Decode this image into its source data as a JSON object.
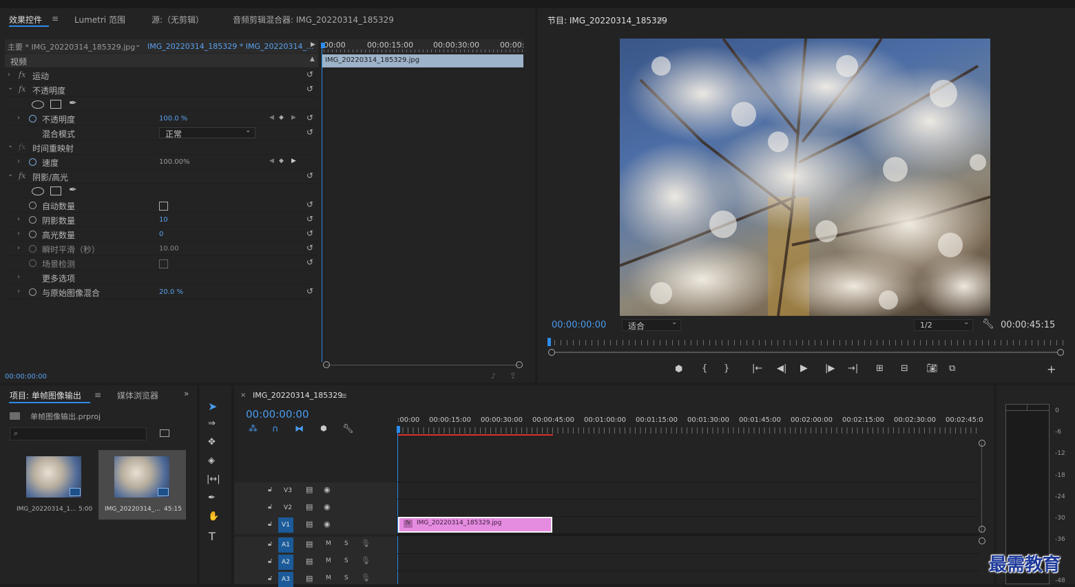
{
  "effect_controls": {
    "tabs": [
      "效果控件",
      "Lumetri 范围",
      "源:（无剪辑）",
      "音频剪辑混合器: IMG_20220314_185329"
    ],
    "master_label": "主要 * IMG_20220314_185329.jpg",
    "sequence_label": "IMG_20220314_185329 * IMG_20220314_...",
    "ruler_times": [
      "00:00",
      "00:00:15:00",
      "00:00:30:00",
      "00:00:"
    ],
    "clip_name": "IMG_20220314_185329.jpg",
    "section_video": "视频",
    "rows": {
      "motion": "运动",
      "opacity_group": "不透明度",
      "opacity": "不透明度",
      "opacity_value": "100.0 %",
      "blend_mode": "混合模式",
      "blend_value": "正常",
      "time_remap": "时间重映射",
      "speed": "速度",
      "speed_value": "100.00%",
      "shadow_highlight": "阴影/高光",
      "auto_amount": "自动数量",
      "shadow_amount": "阴影数量",
      "shadow_value": "10",
      "highlight_amount": "高光数量",
      "highlight_value": "0",
      "temporal_smoothing": "瞬时平滑（秒）",
      "temporal_value": "10.00",
      "scene_detect": "场景检测",
      "more_options": "更多选项",
      "blend_original": "与原始图像混合",
      "blend_original_value": "20.0 %"
    },
    "timecode": "00:00:00:00",
    "fx_symbol": "fx"
  },
  "program_monitor": {
    "title": "节目: IMG_20220314_185329",
    "timecode_current": "00:00:00:00",
    "fit_label": "适合",
    "resolution_label": "1/2",
    "timecode_duration": "00:00:45:15"
  },
  "project_panel": {
    "tab_project": "项目: 单帧图像输出",
    "tab_media": "媒体浏览器",
    "project_file": "单帧图像输出.prproj",
    "items": [
      {
        "name": "IMG_20220314_1...",
        "duration": "5:00"
      },
      {
        "name": "IMG_20220314_...",
        "duration": "45:15"
      }
    ]
  },
  "timeline": {
    "sequence_tab": "IMG_20220314_185329",
    "timecode": "00:00:00:00",
    "ruler_times": [
      ":00:00",
      "00:00:15:00",
      "00:00:30:00",
      "00:00:45:00",
      "00:01:00:00",
      "00:01:15:00",
      "00:01:30:00",
      "00:01:45:00",
      "00:02:00:00",
      "00:02:15:00",
      "00:02:30:00",
      "00:02:45:0"
    ],
    "tracks": [
      "V3",
      "V2",
      "V1",
      "A1",
      "A2",
      "A3"
    ],
    "track_m": "M",
    "track_s": "S",
    "clip_name": "IMG_20220314_185329.jpg"
  },
  "audio_meter": {
    "scale": [
      "0",
      "-6",
      "-12",
      "-18",
      "-24",
      "-30",
      "-36",
      "-48"
    ]
  },
  "watermark": "最需教育",
  "colors": {
    "accent_blue": "#2d8ceb",
    "clip_pink": "#e58be0",
    "timeline_red": "#d9322c"
  }
}
